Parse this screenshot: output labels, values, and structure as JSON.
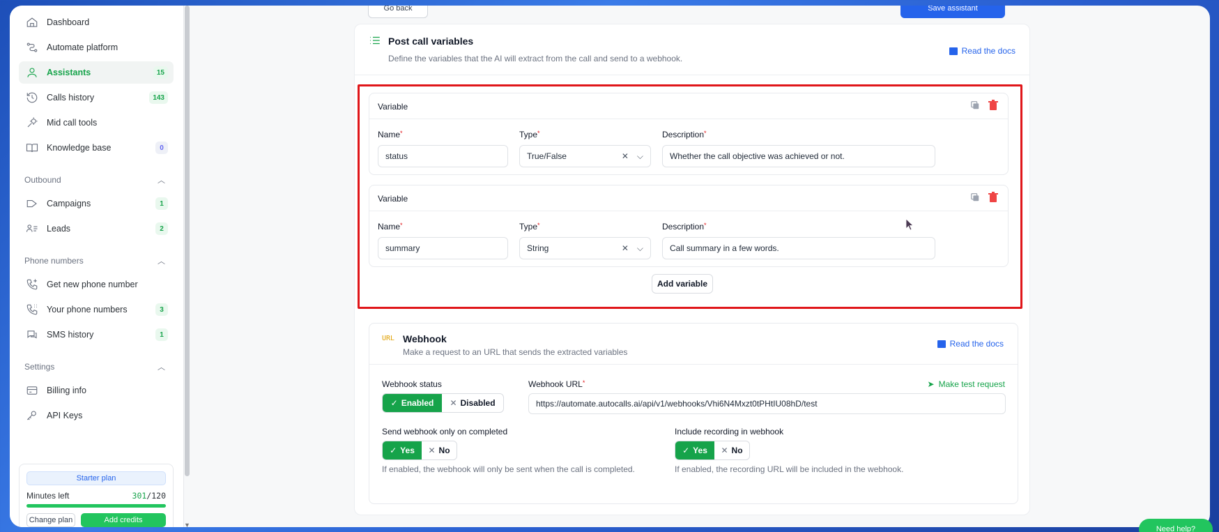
{
  "sidebar": {
    "items": [
      {
        "label": "Dashboard",
        "icon": "home-icon"
      },
      {
        "label": "Automate platform",
        "icon": "workflow-icon"
      },
      {
        "label": "Assistants",
        "icon": "user-icon",
        "badge": "15"
      },
      {
        "label": "Calls history",
        "icon": "history-icon",
        "badge": "143"
      },
      {
        "label": "Mid call tools",
        "icon": "tools-icon"
      },
      {
        "label": "Knowledge base",
        "icon": "book-icon",
        "badge": "0"
      }
    ],
    "outbound": {
      "title": "Outbound",
      "items": [
        {
          "label": "Campaigns",
          "badge": "1"
        },
        {
          "label": "Leads",
          "badge": "2"
        }
      ]
    },
    "phone": {
      "title": "Phone numbers",
      "items": [
        {
          "label": "Get new phone number"
        },
        {
          "label": "Your phone numbers",
          "badge": "3"
        },
        {
          "label": "SMS history",
          "badge": "1"
        }
      ]
    },
    "settings": {
      "title": "Settings",
      "items": [
        {
          "label": "Billing info"
        },
        {
          "label": "API Keys"
        }
      ]
    },
    "plan": {
      "label": "Starter plan",
      "minutes_label": "Minutes left",
      "minutes_used": "301",
      "minutes_total": "/120",
      "change_plan": "Change plan",
      "add_credits": "Add credits"
    }
  },
  "header": {
    "back_label": "Go back",
    "save_label": "Save assistant"
  },
  "post_call": {
    "title": "Post call variables",
    "subtitle": "Define the variables that the AI will extract from the call and send to a webhook.",
    "docs_label": "Read the docs",
    "variables": [
      {
        "heading": "Variable",
        "name_label": "Name",
        "type_label": "Type",
        "desc_label": "Description",
        "name": "status",
        "type": "True/False",
        "description": "Whether the call objective was achieved or not."
      },
      {
        "heading": "Variable",
        "name_label": "Name",
        "type_label": "Type",
        "desc_label": "Description",
        "name": "summary",
        "type": "String",
        "description": "Call summary in a few words."
      }
    ],
    "add_label": "Add variable"
  },
  "webhook": {
    "icon_text": "URL",
    "title": "Webhook",
    "subtitle": "Make a request to an URL that sends the extracted variables",
    "docs_label": "Read the docs",
    "status_label": "Webhook status",
    "enabled_label": "Enabled",
    "disabled_label": "Disabled",
    "url_label": "Webhook URL",
    "url_value": "https://automate.autocalls.ai/api/v1/webhooks/Vhi6N4Mxzt0tPHtIU08hD/test",
    "test_label": "Make test request",
    "completed_label": "Send webhook only on completed",
    "completed_yes": "Yes",
    "completed_no": "No",
    "completed_hint": "If enabled, the webhook will only be sent when the call is completed.",
    "recording_label": "Include recording in webhook",
    "recording_yes": "Yes",
    "recording_no": "No",
    "recording_hint": "If enabled, the recording URL will be included in the webhook."
  },
  "help_label": "Need help?",
  "colors": {
    "accent": "#16a34a",
    "link": "#2563eb",
    "highlight": "#e0161a"
  }
}
